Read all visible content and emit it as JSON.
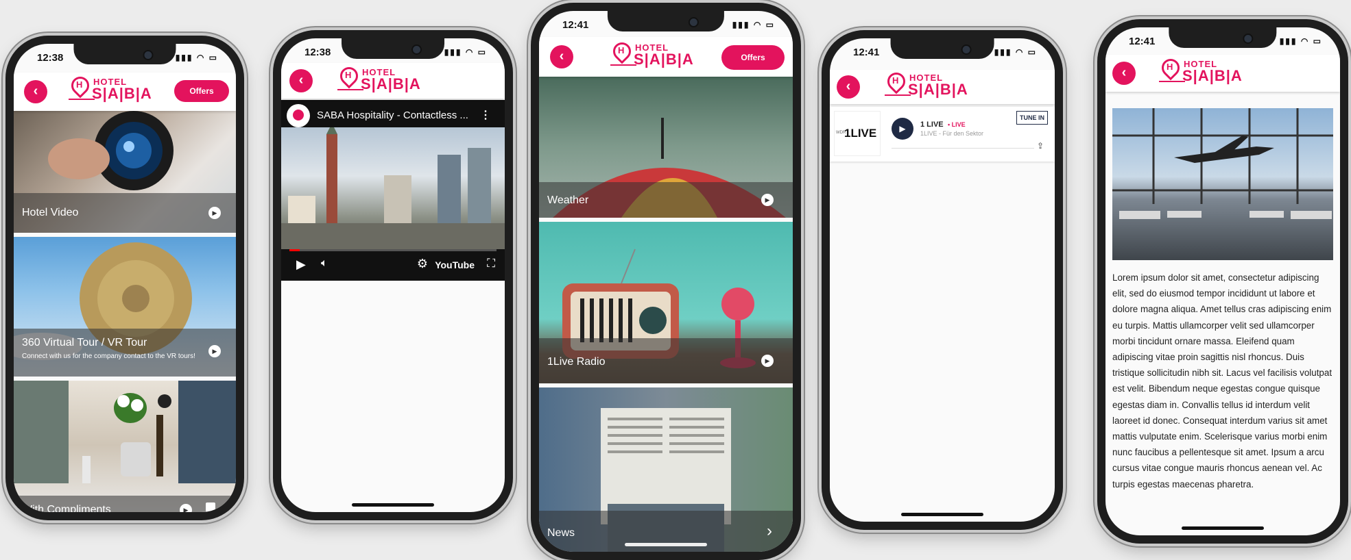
{
  "brand": {
    "accent": "#e3135d",
    "logo_top": "HOTEL",
    "logo_main": "S|A|B|A",
    "offers_label": "Offers",
    "back_icon": "chevron-left-icon"
  },
  "phone1": {
    "time": "12:38",
    "tiles": [
      {
        "title": "Hotel Video",
        "subtitle": ""
      },
      {
        "title": "360 Virtual Tour / VR Tour",
        "subtitle": "Connect with us for the company contact to the VR tours!"
      },
      {
        "title": "With Compliments",
        "subtitle": ""
      }
    ]
  },
  "phone2": {
    "time": "12:38",
    "video_title": "SABA Hospitality - Contactless ...",
    "player_brand": "YouTube",
    "progress": 0.05
  },
  "phone3": {
    "time": "12:41",
    "tiles": [
      {
        "title": "Weather"
      },
      {
        "title": "1Live Radio"
      },
      {
        "title": "News"
      }
    ]
  },
  "phone4": {
    "time": "12:41",
    "station_logo": "1LIVE",
    "station_prefix": "WDR",
    "station_name": "1 LIVE",
    "live_badge": "• LIVE",
    "station_sub": "1LIVE - Für den Sektor",
    "tunein": "TUNE IN"
  },
  "phone5": {
    "time": "12:41",
    "body": "Lorem ipsum dolor sit amet, consectetur adipiscing elit, sed do eiusmod tempor incididunt ut labore et dolore magna aliqua. Amet tellus cras adipiscing enim eu turpis. Mattis ullamcorper velit sed ullamcorper morbi tincidunt ornare massa. Eleifend quam adipiscing vitae proin sagittis nisl rhoncus. Duis tristique sollicitudin nibh sit. Lacus vel facilisis volutpat est velit. Bibendum neque egestas congue quisque egestas diam in. Convallis tellus id interdum velit laoreet id donec. Consequat interdum varius sit amet mattis vulputate enim. Scelerisque varius morbi enim nunc faucibus a pellentesque sit amet. Ipsum a arcu cursus vitae congue mauris rhoncus aenean vel. Ac turpis egestas maecenas pharetra."
  }
}
